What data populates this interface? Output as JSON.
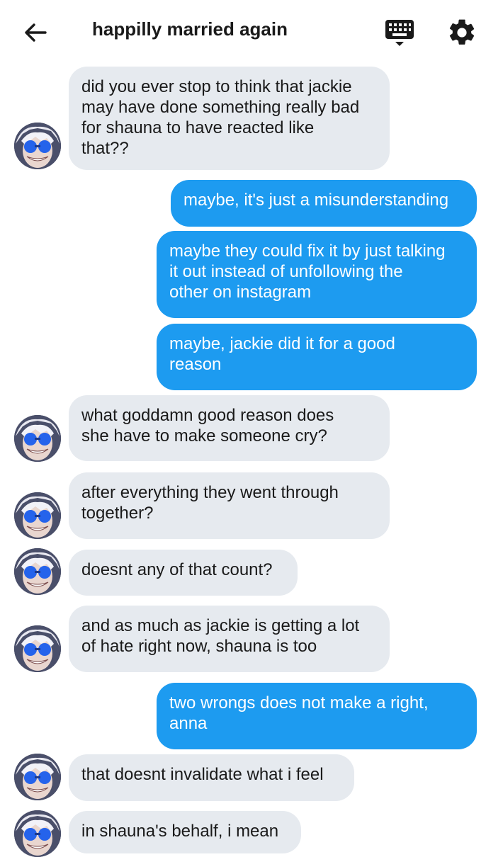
{
  "header": {
    "title": "happilly married again",
    "back_icon": "arrow-left-icon",
    "keyboard_icon": "keyboard-icon",
    "settings_icon": "gear-icon"
  },
  "colors": {
    "incoming_bubble": "#e6eaef",
    "outgoing_bubble": "#1d9bf0",
    "outgoing_text": "#ffffff"
  },
  "messages": [
    {
      "sender": "them",
      "text": "did you ever stop to think that jackie\nmay have done something really bad\nfor shauna to have reacted like\nthat??"
    },
    {
      "sender": "me",
      "text": "maybe, it's just a misunderstanding"
    },
    {
      "sender": "me",
      "text": "maybe they could fix it by just talking\nit out instead of unfollowing the\nother on instagram"
    },
    {
      "sender": "me",
      "text": "maybe, jackie did it for a good\nreason"
    },
    {
      "sender": "them",
      "text": "what goddamn good reason does\nshe have to make someone cry?"
    },
    {
      "sender": "them",
      "text": "after everything they went through\ntogether?"
    },
    {
      "sender": "them",
      "text": "doesnt any of that count?"
    },
    {
      "sender": "them",
      "text": "and as much as jackie is getting a lot\nof hate right now, shauna is too"
    },
    {
      "sender": "me",
      "text": "two wrongs does not make a right,\nanna"
    },
    {
      "sender": "them",
      "text": "that doesnt invalidate what i feel"
    },
    {
      "sender": "them",
      "text": "in shauna's behalf, i mean"
    }
  ]
}
